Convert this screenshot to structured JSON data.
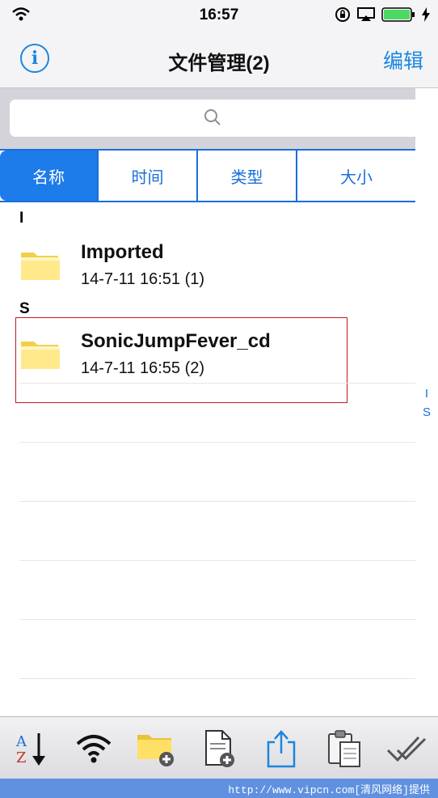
{
  "status_bar": {
    "time": "16:57",
    "icons": [
      "wifi-icon",
      "rotation-lock-icon",
      "airplay-icon",
      "battery-icon",
      "charging-bolt-icon"
    ],
    "battery_color": "#4cd964"
  },
  "nav": {
    "info_icon": "info-icon",
    "info_glyph": "i",
    "title": "文件管理(2)",
    "edit_label": "编辑"
  },
  "search": {
    "placeholder": "",
    "icon": "search-icon"
  },
  "sort_tabs": [
    {
      "label": "名称",
      "selected": true
    },
    {
      "label": "时间",
      "selected": false
    },
    {
      "label": "类型",
      "selected": false
    },
    {
      "label": "大小",
      "selected": false
    }
  ],
  "sections": [
    {
      "header": "I",
      "items": [
        {
          "name": "Imported",
          "meta": "14-7-11 16:51 (1)",
          "icon": "folder-icon"
        }
      ]
    },
    {
      "header": "S",
      "items": [
        {
          "name": "SonicJumpFever_cd",
          "meta": "14-7-11 16:55 (2)",
          "icon": "folder-icon"
        }
      ]
    }
  ],
  "section_index": [
    "I",
    "S"
  ],
  "toolbar": [
    "sort-az-icon",
    "wifi-transfer-icon",
    "new-folder-icon",
    "new-file-icon",
    "share-icon",
    "paste-icon",
    "select-all-icon"
  ],
  "footer_watermark": "http://www.vipcn.com[清风网络]提供",
  "colors": {
    "accent": "#1a86e0",
    "selected_tab": "#1d7bea",
    "highlight_border": "#c01a1a"
  }
}
